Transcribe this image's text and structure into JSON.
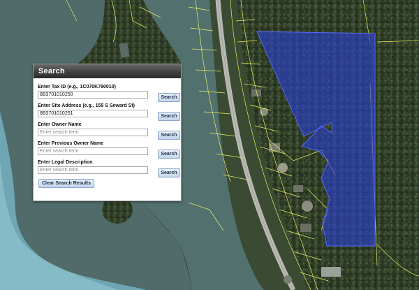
{
  "search_panel": {
    "title": "Search",
    "fields": [
      {
        "label": "Enter Tax ID (e.g., 1C070K790010)",
        "value": "8B3701010250",
        "placeholder": "",
        "button_label": "Search"
      },
      {
        "label": "Enter Site Address (e.g., 155 S Seward St)",
        "value": "8B3701010251",
        "placeholder": "",
        "button_label": "Search"
      },
      {
        "label": "Enter Owner Name",
        "value": "",
        "placeholder": "Enter search term",
        "button_label": "Search"
      },
      {
        "label": "Enter Previous Owner Name",
        "value": "",
        "placeholder": "Enter search term",
        "button_label": "Search"
      },
      {
        "label": "Enter Legal Description",
        "value": "",
        "placeholder": "Enter search term",
        "button_label": "Search"
      }
    ],
    "clear_label": "Clear Search Results"
  },
  "map": {
    "water_color": "#506b69",
    "forest_color": "#2f3d27",
    "parcel_line_color": "#e8f06a",
    "selection_fill": "#2a3fd6",
    "selection_stroke": "#5566ff"
  }
}
